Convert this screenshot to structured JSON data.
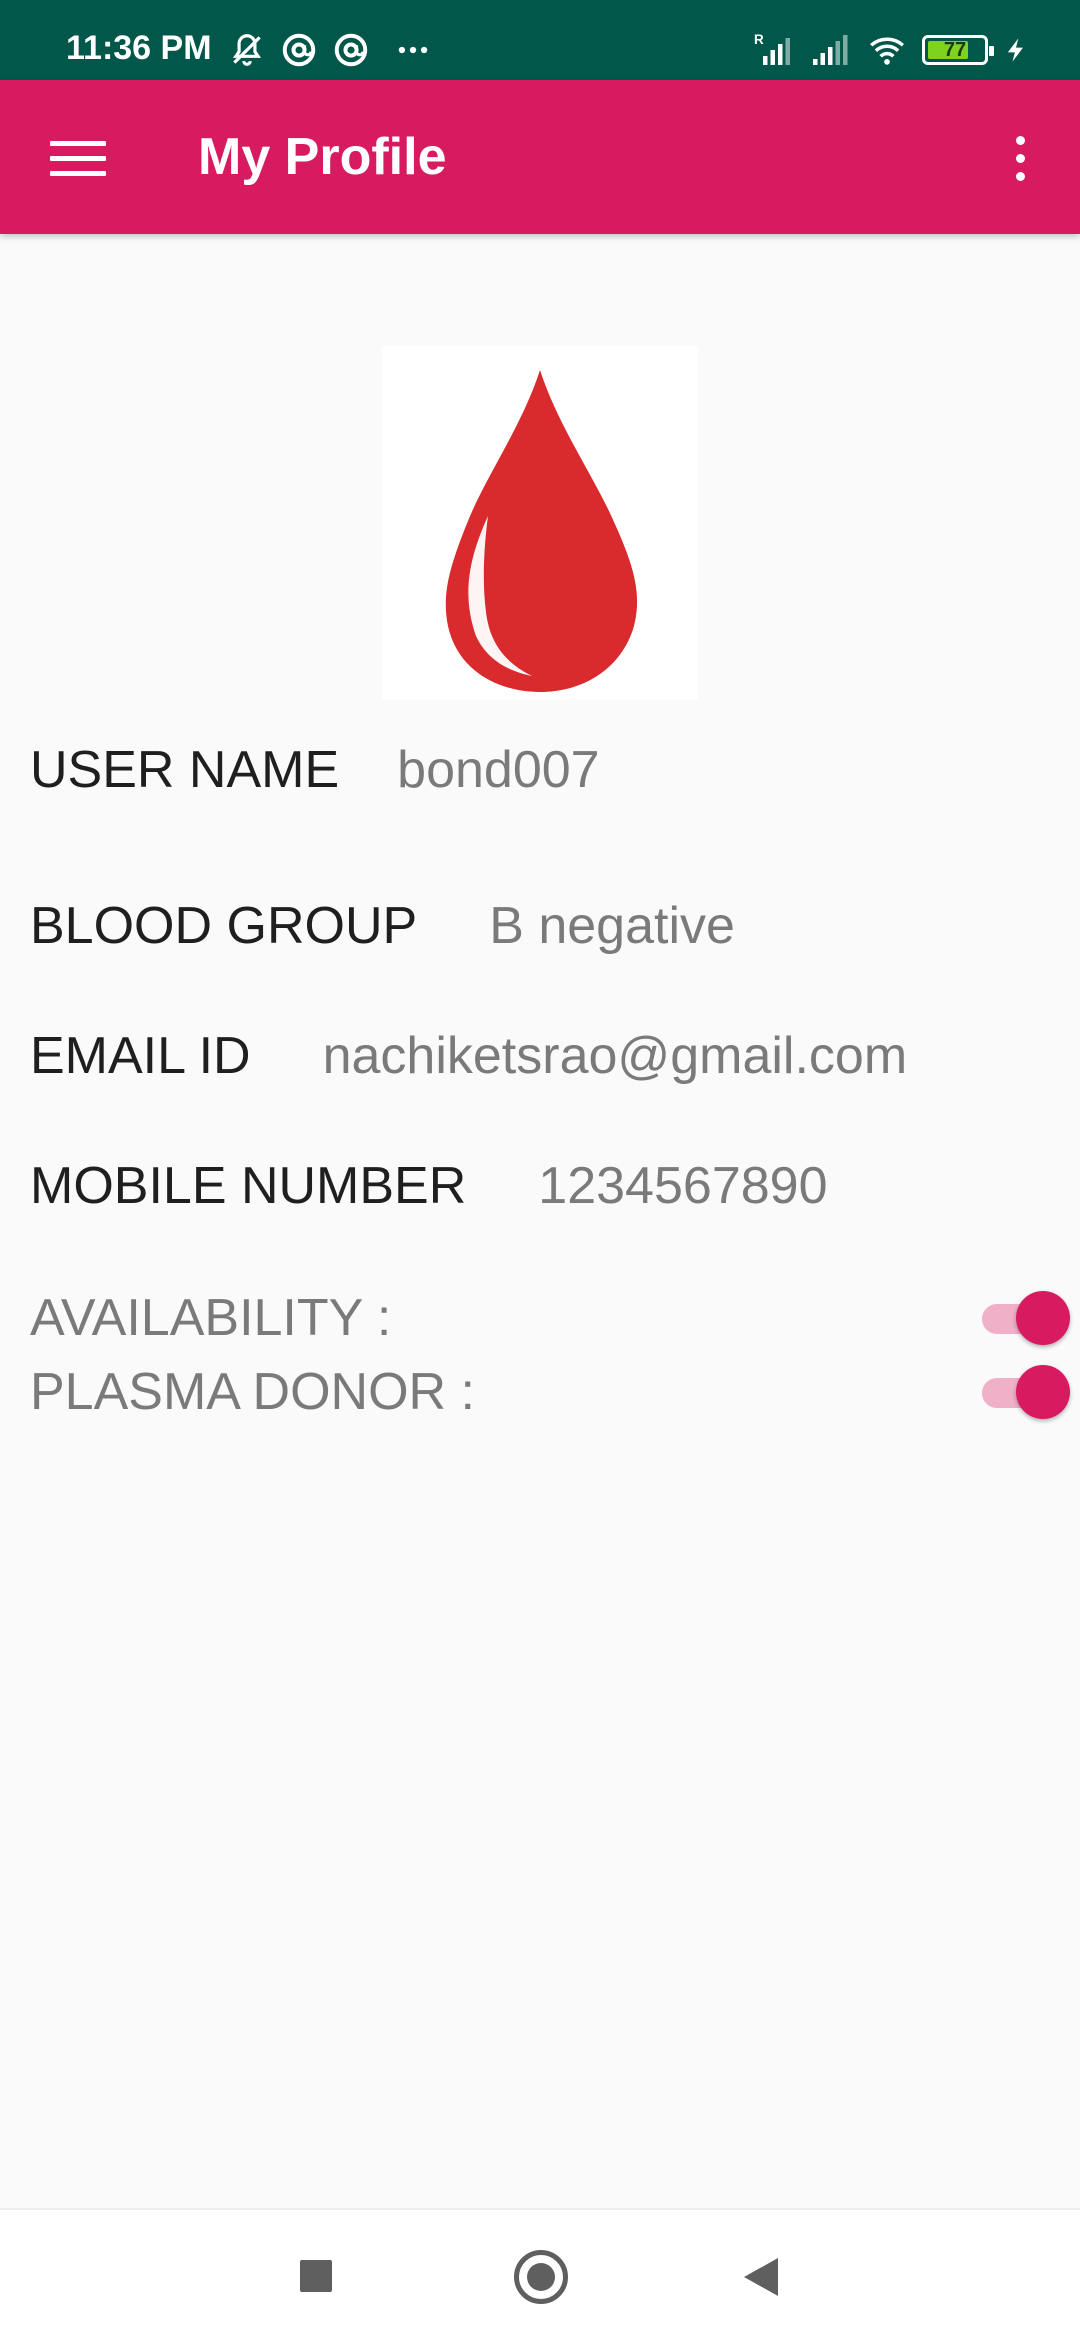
{
  "status_bar": {
    "time": "11:36 PM",
    "left_icons": [
      "bell-off-icon",
      "at-sign-icon",
      "at-sign-icon",
      "more-dots-icon"
    ],
    "right_icons": [
      "signal-roaming-icon",
      "signal-icon",
      "wifi-icon",
      "battery-icon",
      "charging-icon"
    ],
    "battery_level": "77",
    "battery_fraction": 0.77
  },
  "app_bar": {
    "title": "My Profile",
    "color": "#d81b60"
  },
  "profile": {
    "image_icon": "blood-drop-icon",
    "username_label": "USER NAME",
    "username_value": "bond007",
    "blood_group_label": "BLOOD GROUP",
    "blood_group_value": "B negative",
    "email_label": "EMAIL ID",
    "email_value": "nachiketsrao@gmail.com",
    "mobile_label": "MOBILE NUMBER",
    "mobile_value": "1234567890"
  },
  "toggles": {
    "availability_label": "AVAILABILITY :",
    "availability_on": true,
    "plasma_label": "PLASMA DONOR :",
    "plasma_on": true
  },
  "colors": {
    "status_bar": "#01574a",
    "accent": "#d81b60",
    "drop": "#d92a2e"
  }
}
